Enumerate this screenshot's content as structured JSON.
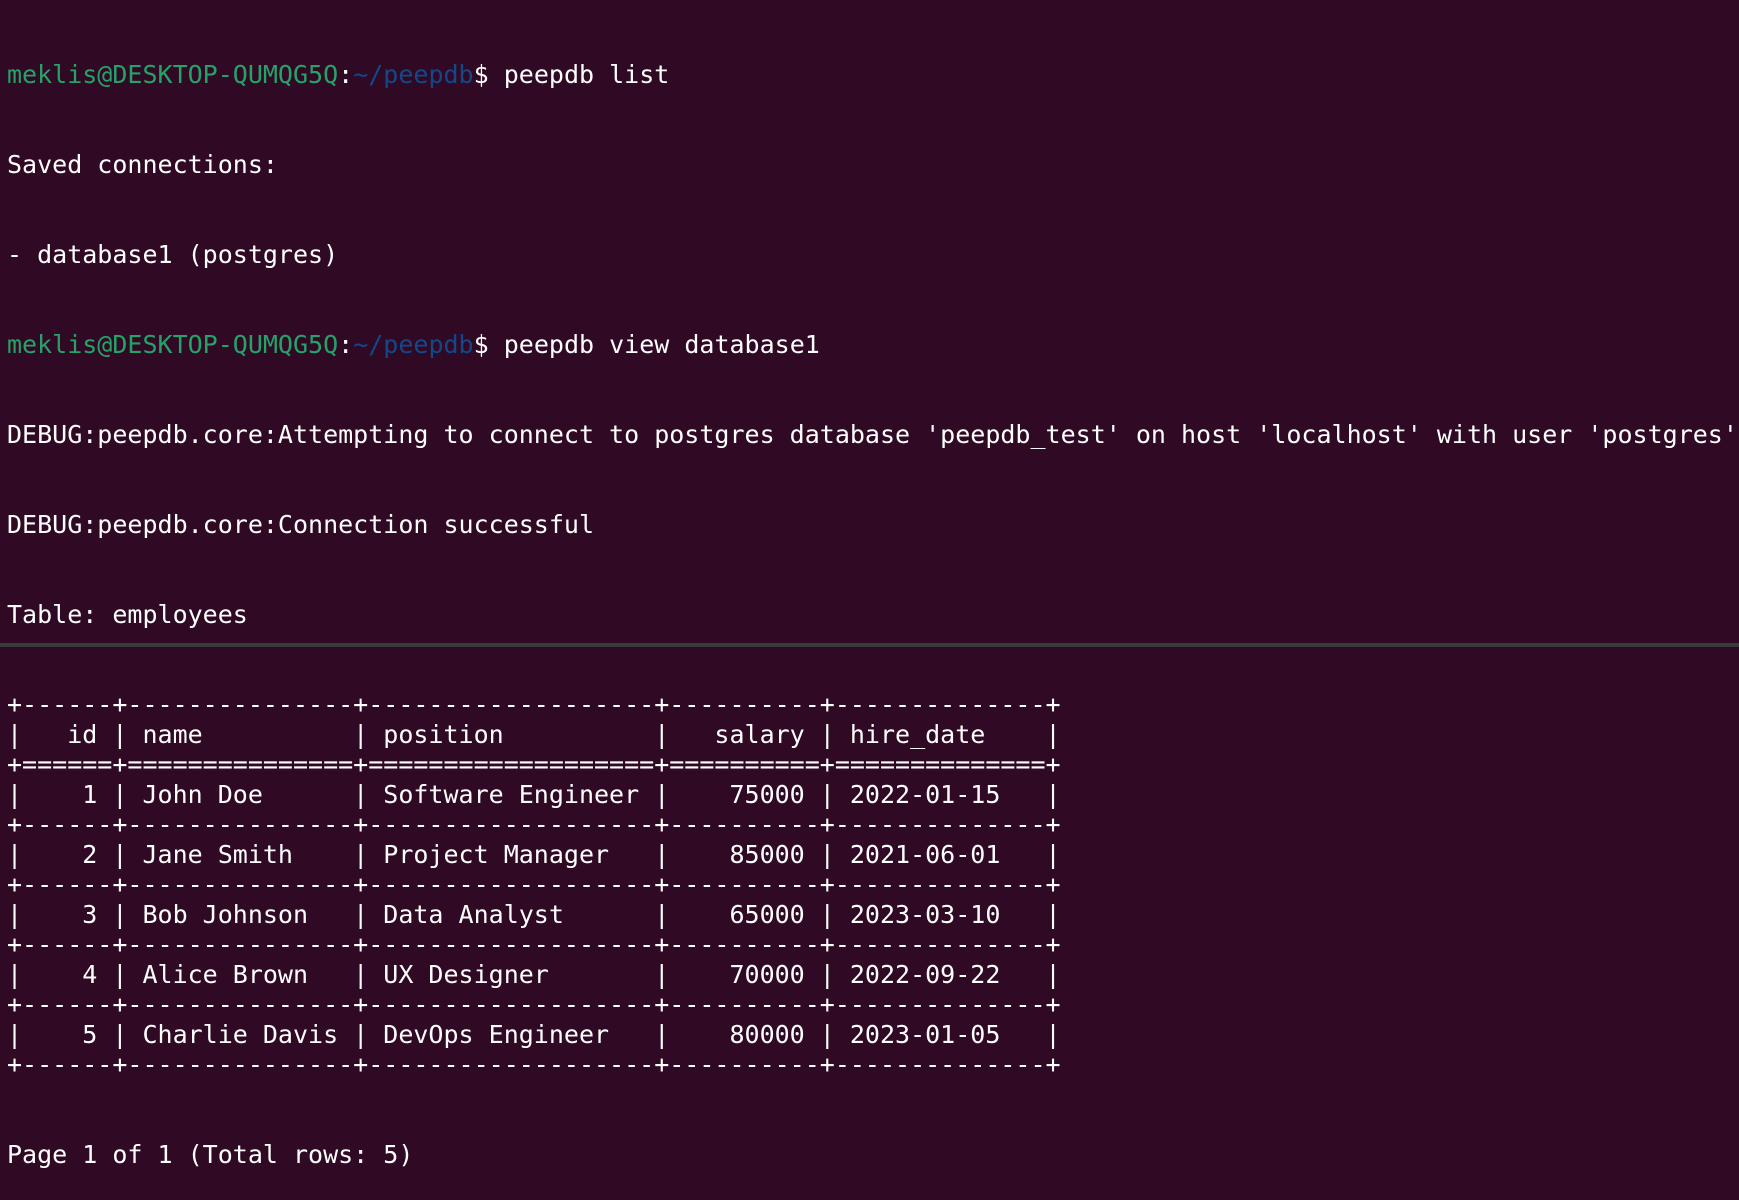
{
  "colors": {
    "background": "#300a24",
    "prompt_user": "#26a269",
    "prompt_path": "#12488b",
    "text": "#ffffff"
  },
  "prompt": {
    "user_host": "meklis@DESKTOP-QUMQG5Q",
    "colon": ":",
    "path": "~/peepdb",
    "dollar": "$"
  },
  "commands": [
    {
      "command": " peepdb list"
    },
    {
      "command": " peepdb view database1"
    }
  ],
  "list_output": [
    "Saved connections:",
    "- database1 (postgres)"
  ],
  "view_output": [
    "DEBUG:peepdb.core:Attempting to connect to postgres database 'peepdb_test' on host 'localhost' with user 'postgres'",
    "DEBUG:peepdb.core:Connection successful",
    "Table: employees"
  ],
  "table": {
    "columns": [
      "id",
      "name",
      "position",
      "salary",
      "hire_date"
    ],
    "rows": [
      [
        "1",
        "John Doe",
        "Software Engineer",
        "75000",
        "2022-01-15"
      ],
      [
        "2",
        "Jane Smith",
        "Project Manager",
        "85000",
        "2021-06-01"
      ],
      [
        "3",
        "Bob Johnson",
        "Data Analyst",
        "65000",
        "2023-03-10"
      ],
      [
        "4",
        "Alice Brown",
        "UX Designer",
        "70000",
        "2022-09-22"
      ],
      [
        "5",
        "Charlie Davis",
        "DevOps Engineer",
        "80000",
        "2023-01-05"
      ]
    ]
  },
  "footer": "Page 1 of 1 (Total rows: 5)"
}
